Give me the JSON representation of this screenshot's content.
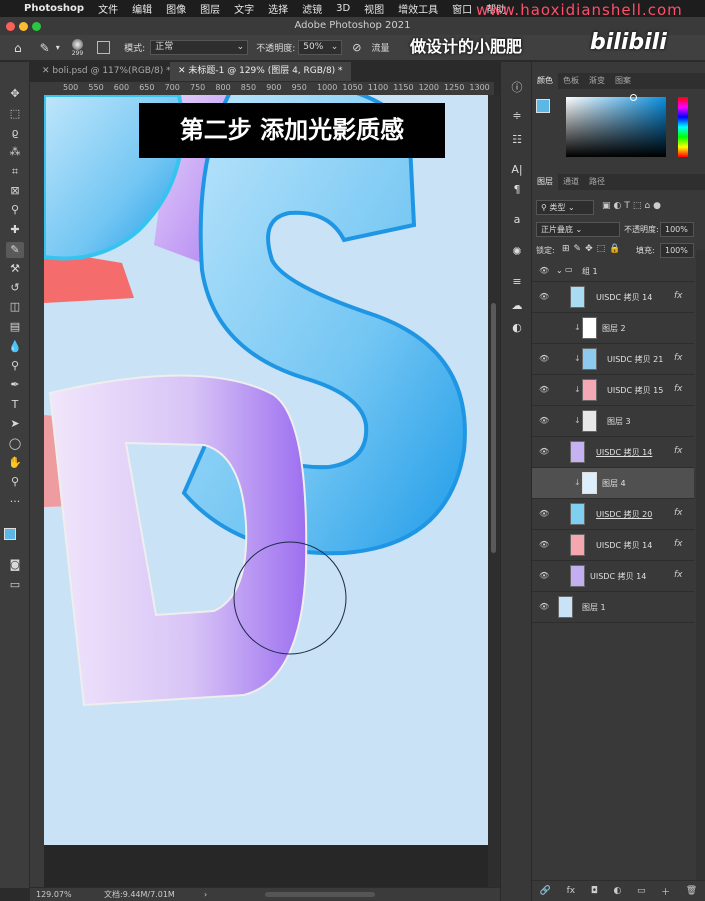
{
  "menubar": {
    "app": "Photoshop",
    "items": [
      "文件",
      "编辑",
      "图像",
      "图层",
      "文字",
      "选择",
      "滤镜",
      "3D",
      "视图",
      "增效工具",
      "窗口",
      "帮助"
    ]
  },
  "watermark": {
    "url": "www.haoxidianshell.com",
    "brand": "做设计的小肥肥",
    "bili": "bilibili"
  },
  "window": {
    "title": "Adobe Photoshop 2021"
  },
  "options": {
    "brush_size": "299",
    "mode_label": "模式:",
    "mode_value": "正常",
    "opacity_label": "不透明度:",
    "opacity_value": "50%",
    "flow_label": "流量"
  },
  "tabs": [
    {
      "label": "boli.psd @ 117%(RGB/8) *"
    },
    {
      "label": "未标题-1 @ 129% (图层 4, RGB/8) *"
    }
  ],
  "ruler": {
    "ticks": [
      "500",
      "550",
      "600",
      "650",
      "700",
      "750",
      "800",
      "850",
      "900",
      "950",
      "1000",
      "1050",
      "1100",
      "1150",
      "1200",
      "1250",
      "1300"
    ]
  },
  "canvas": {
    "banner": "第二步 添加光影质感"
  },
  "status": {
    "zoom": "129.07%",
    "doc": "文档:9.44M/7.01M",
    "arrow": "›"
  },
  "color_panel": {
    "tabs": [
      "颜色",
      "色板",
      "渐变",
      "图案"
    ]
  },
  "layers_panel": {
    "tabs": [
      "图层",
      "通道",
      "路径"
    ],
    "filter": "类型",
    "blend": "正片叠底",
    "opacity_label": "不透明度:",
    "opacity": "100%",
    "lock_label": "锁定:",
    "fill_label": "填充:",
    "fill": "100%",
    "group": "组 1",
    "layers": [
      {
        "name": "UISDC 拷贝 14",
        "fx": "fx",
        "clip": "",
        "thumb": "#a9dcf2"
      },
      {
        "name": "图层 2",
        "fx": "",
        "clip": "↓",
        "thumb": "#ffffff"
      },
      {
        "name": "UISDC 拷贝 21",
        "fx": "fx",
        "clip": "↓",
        "thumb": "#8ec9f0"
      },
      {
        "name": "UISDC 拷贝 15",
        "fx": "fx",
        "clip": "↓",
        "thumb": "#f4a7b4"
      },
      {
        "name": "图层 3",
        "fx": "",
        "clip": "↓",
        "thumb": "#e8e8e8"
      },
      {
        "name": "UISDC 拷贝 14",
        "fx": "fx",
        "clip": "",
        "thumb": "#c6b2f2"
      },
      {
        "name": "图层 4",
        "fx": "",
        "clip": "↓",
        "thumb": "#dceefb"
      },
      {
        "name": "UISDC 拷贝 20",
        "fx": "fx",
        "clip": "",
        "thumb": "#7fd0f0"
      },
      {
        "name": "UISDC 拷贝 14",
        "fx": "fx",
        "clip": "",
        "thumb": "#f5a7b0"
      },
      {
        "name": "UISDC 拷贝 14",
        "fx": "fx",
        "clip": "",
        "thumb": "#c3aef2"
      },
      {
        "name": "图层 1",
        "fx": "",
        "clip": "",
        "thumb": "#c9e2f5"
      }
    ],
    "footer": [
      "🔗",
      "fx",
      "◘",
      "◐",
      "▭",
      "＋",
      "🗑"
    ]
  }
}
